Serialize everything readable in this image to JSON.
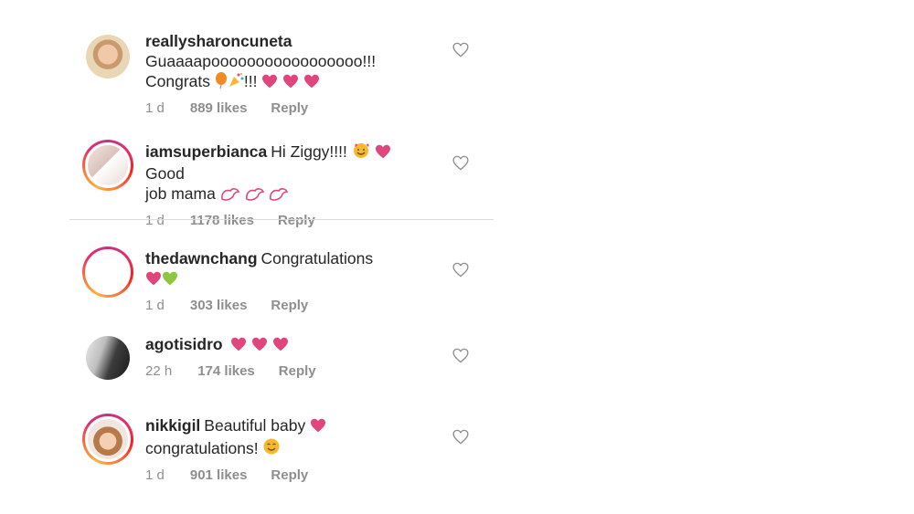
{
  "comments": [
    {
      "username": "reallysharoncuneta",
      "text_lines": [
        "Guaaaapooooooooooooooooo!!!",
        "Congrats"
      ],
      "text_tail": "!!!",
      "time": "1 d",
      "likes": "889 likes",
      "reply": "Reply"
    },
    {
      "username": "iamsuperbianca",
      "text_a": "Hi Ziggy!!!!",
      "text_b": "Good",
      "text_c": "job mama",
      "time": "1 d",
      "likes": "1178 likes",
      "reply": "Reply"
    },
    {
      "username": "thedawnchang",
      "text": "Congratulations",
      "time": "1 d",
      "likes": "303 likes",
      "reply": "Reply"
    },
    {
      "username": "agotisidro",
      "text": "",
      "time": "22 h",
      "likes": "174 likes",
      "reply": "Reply"
    },
    {
      "username": "nikkigil",
      "text_a": "Beautiful baby",
      "text_b": "congratulations!",
      "time": "1 d",
      "likes": "901 likes",
      "reply": "Reply"
    }
  ],
  "icons": {
    "like": "heart-outline-icon",
    "pink_heart": "pink-heart-emoji",
    "green_heart": "green-heart-emoji"
  },
  "colors": {
    "text": "#262626",
    "meta": "#8e8e8e",
    "pink_heart": "#e0457b",
    "green_heart": "#8dc63f",
    "divider": "#dbdbdb"
  }
}
